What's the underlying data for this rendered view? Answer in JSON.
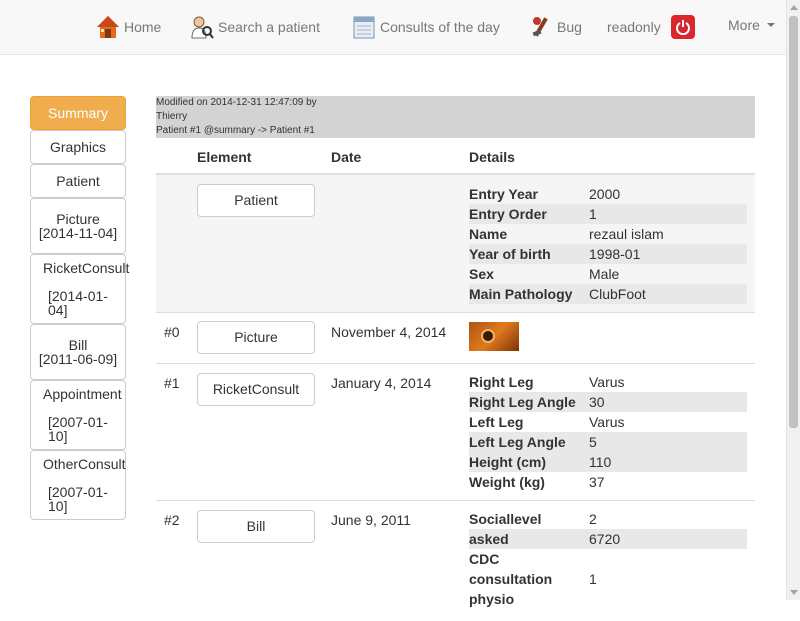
{
  "nav": {
    "home": "Home",
    "search": "Search a patient",
    "consults": "Consults of the day",
    "bug": "Bug",
    "user": "readonly",
    "more": "More"
  },
  "sidebar": {
    "items": [
      {
        "label": "Summary"
      },
      {
        "label": "Graphics"
      },
      {
        "label": "Patient"
      },
      {
        "label": "Picture",
        "date": "[2014-11-04]"
      },
      {
        "label": "RicketConsult",
        "date": "[2014-01-04]"
      },
      {
        "label": "Bill",
        "date": "[2011-06-09]"
      },
      {
        "label": "Appointment",
        "date": "[2007-01-10]"
      },
      {
        "label": "OtherConsult",
        "date": "[2007-01-10]"
      }
    ]
  },
  "meta": {
    "line1": "Modified on 2014-12-31 12:47:09 by Thierry",
    "line2": "Patient #1 @summary -> Patient #1"
  },
  "table": {
    "headers": [
      "Element",
      "Date",
      "Details"
    ],
    "patient": {
      "button": "Patient",
      "details": [
        {
          "k": "Entry Year",
          "v": "2000"
        },
        {
          "k": "Entry Order",
          "v": "1"
        },
        {
          "k": "Name",
          "v": "rezaul islam"
        },
        {
          "k": "Year of birth",
          "v": "1998-01"
        },
        {
          "k": "Sex",
          "v": "Male"
        },
        {
          "k": "Main Pathology",
          "v": "ClubFoot"
        }
      ]
    },
    "picture": {
      "index": "#0",
      "button": "Picture",
      "date": "November 4, 2014"
    },
    "ricket": {
      "index": "#1",
      "button": "RicketConsult",
      "date": "January 4, 2014",
      "details": [
        {
          "k": "Right Leg",
          "v": "Varus"
        },
        {
          "k": "Right Leg Angle",
          "v": "30"
        },
        {
          "k": "Left Leg",
          "v": "Varus"
        },
        {
          "k": "Left Leg Angle",
          "v": "5"
        },
        {
          "k": "Height (cm)",
          "v": "110"
        },
        {
          "k": "Weight (kg)",
          "v": "37"
        }
      ]
    },
    "bill": {
      "index": "#2",
      "button": "Bill",
      "date": "June 9, 2011",
      "details": [
        {
          "k": "Sociallevel",
          "v": "2"
        },
        {
          "k": "asked",
          "v": "6720"
        },
        {
          "k": "CDC",
          "v": ""
        },
        {
          "k": "consultation",
          "v": "1"
        },
        {
          "k": "physio",
          "v": ""
        }
      ]
    }
  },
  "colors": {
    "accent": "#f0ad4e",
    "power": "#d9272e",
    "meta_bg": "#d3d3d3"
  },
  "icons": {
    "home": "home-icon",
    "search": "doctor-search-icon",
    "consults": "calendar-icon",
    "bug": "bug-icon",
    "logout": "power-icon"
  }
}
